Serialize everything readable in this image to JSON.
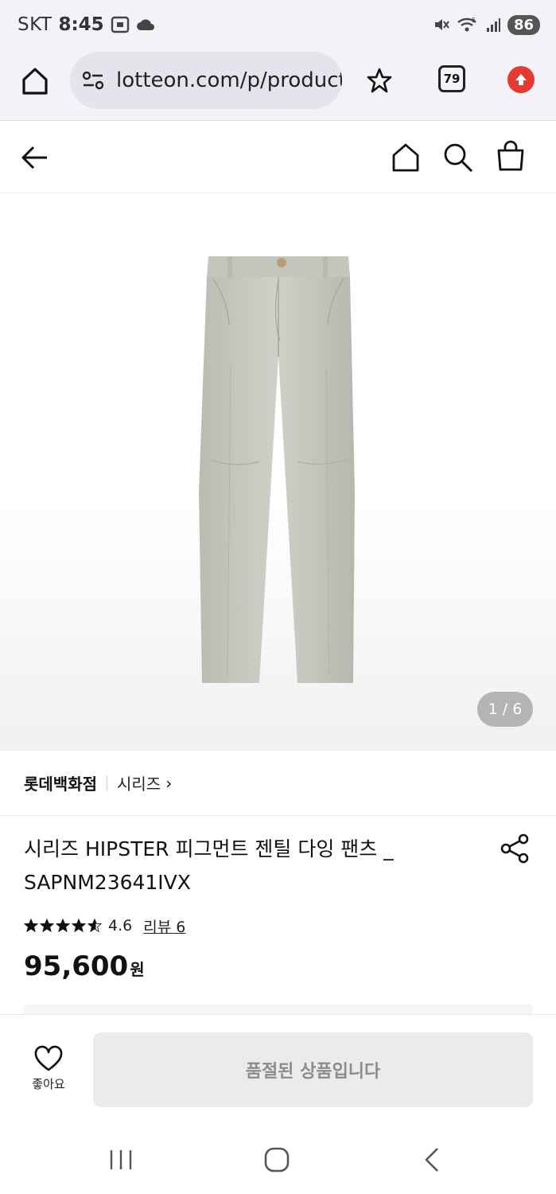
{
  "status_bar": {
    "carrier": "SKT",
    "time": "8:45",
    "battery": "86"
  },
  "browser": {
    "url": "lotteon.com/p/product/",
    "tab_count": "79"
  },
  "product": {
    "image_counter": "1 / 6",
    "brand": "롯데백화점",
    "sub_brand": "시리즈",
    "title": "시리즈 HIPSTER 피그먼트 젠틸 다잉 팬츠 _ SAPNM23641IVX",
    "rating": "4.6",
    "rating_stars": 4.6,
    "review_label": "리뷰 6",
    "price": "95,600",
    "price_unit": "원",
    "pants_color": "#c9cbc1"
  },
  "action_bar": {
    "like_label": "좋아요",
    "soldout_label": "품절된 상품입니다"
  }
}
